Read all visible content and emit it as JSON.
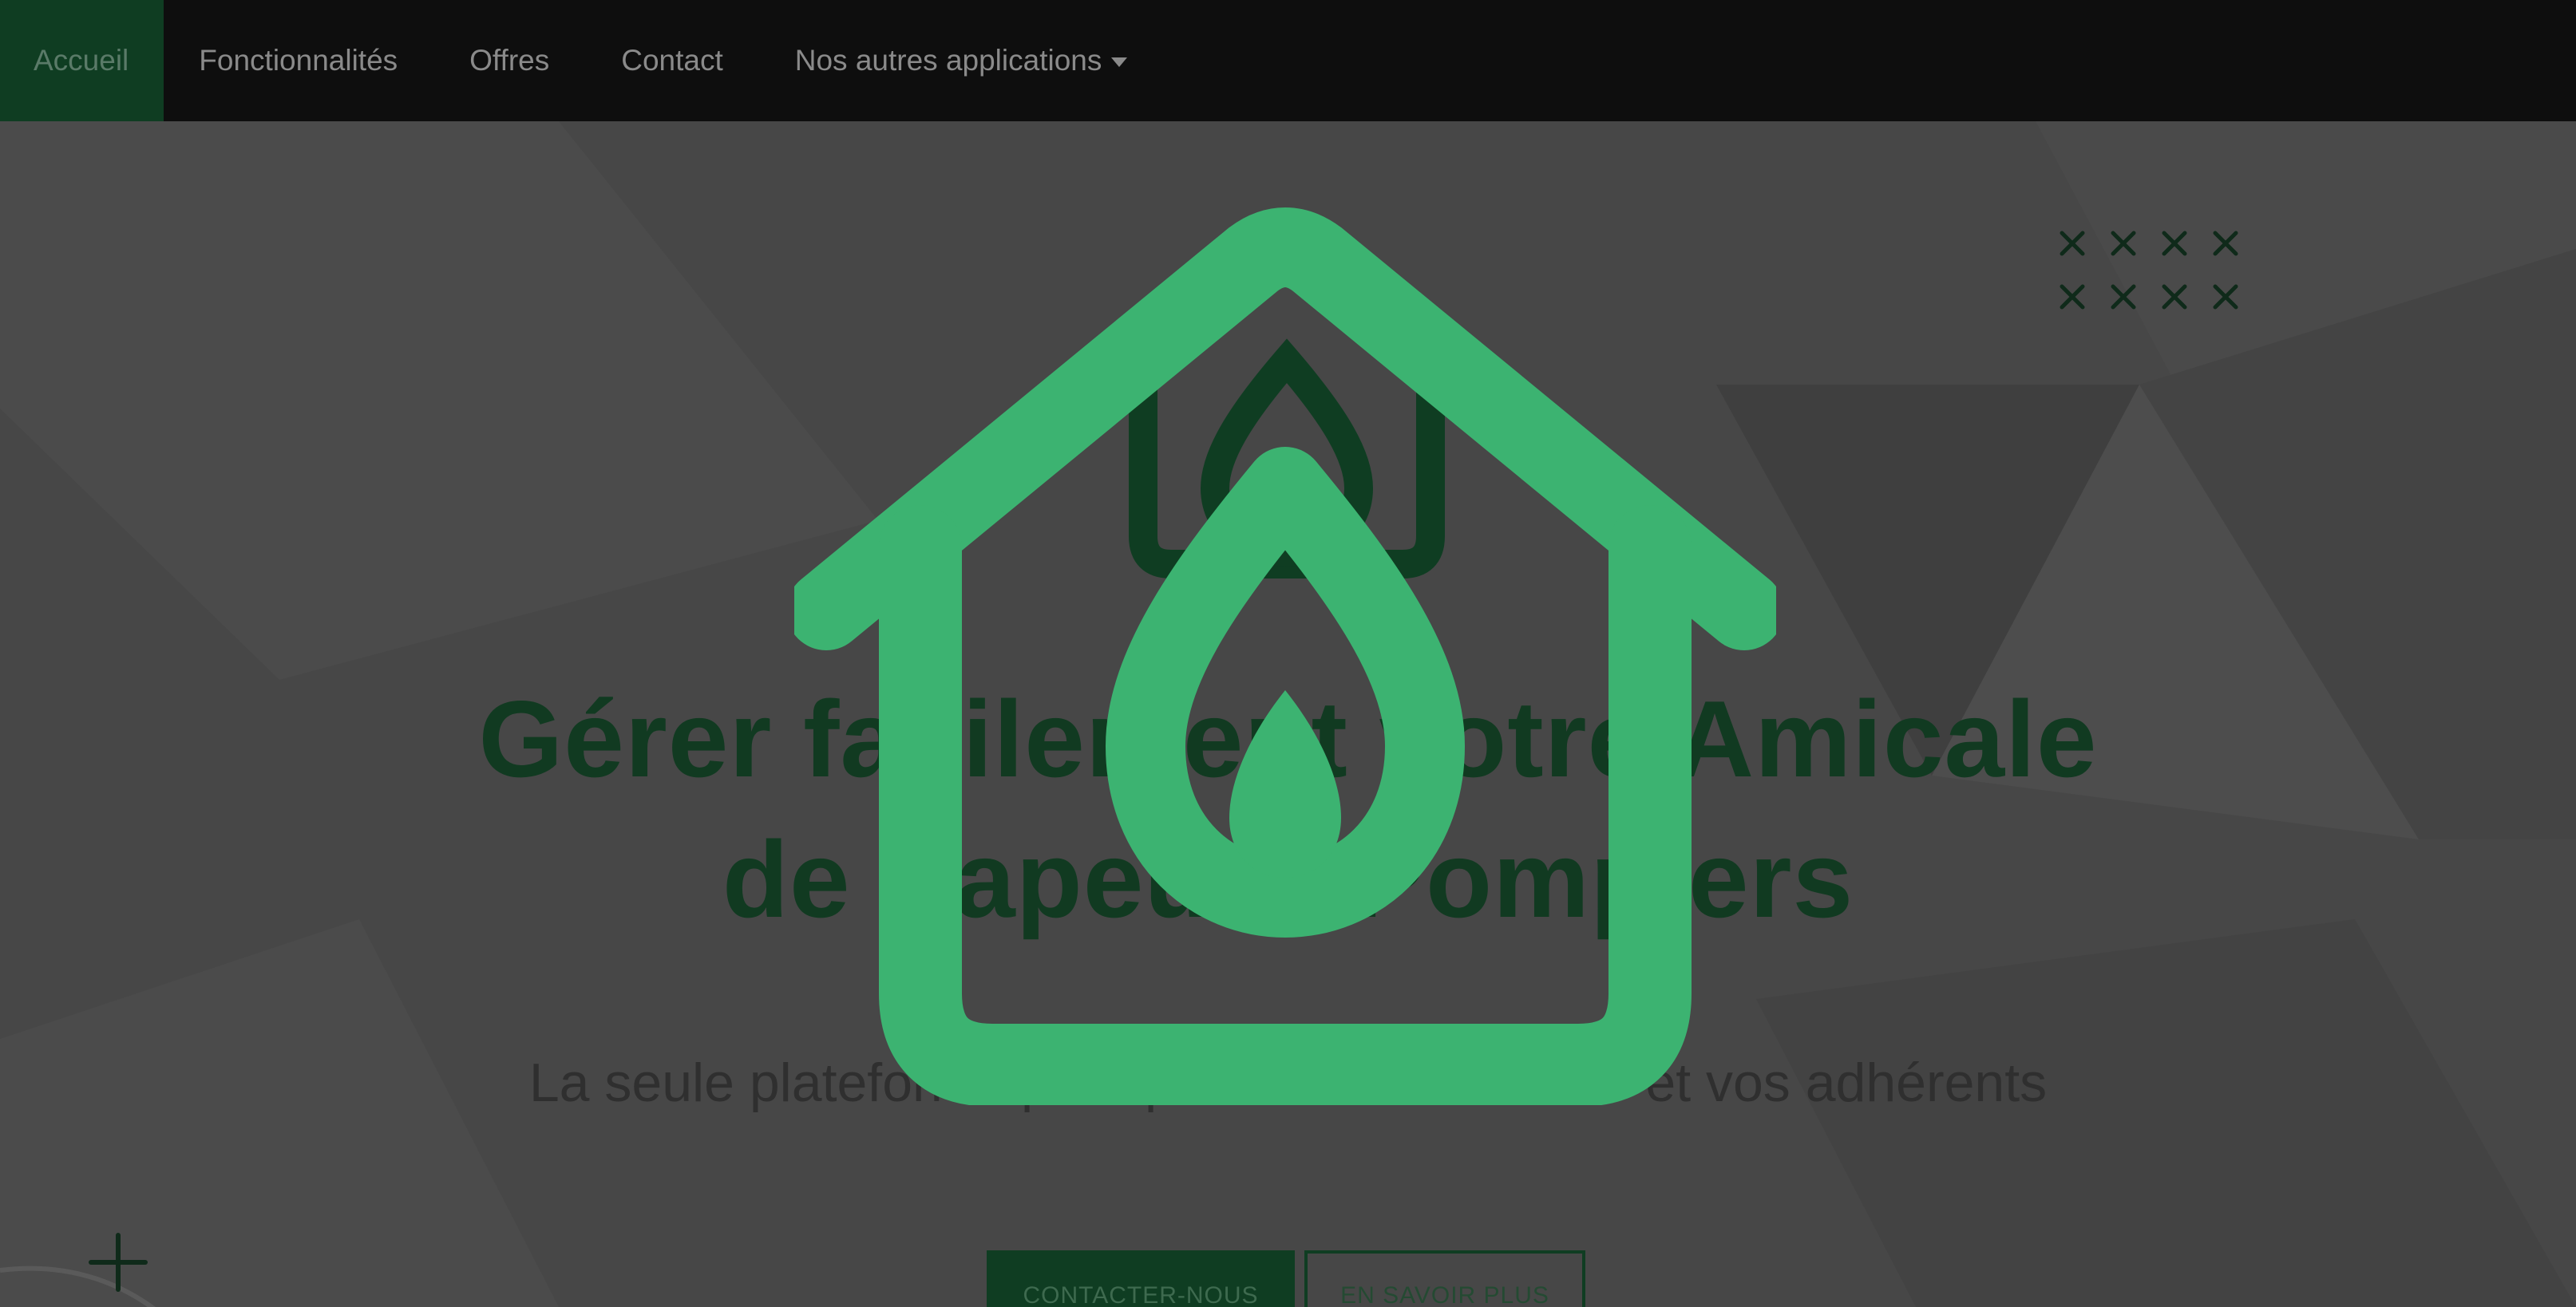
{
  "nav": {
    "items": [
      {
        "label": "Accueil",
        "active": true
      },
      {
        "label": "Fonctionnalités",
        "active": false
      },
      {
        "label": "Offres",
        "active": false
      },
      {
        "label": "Contact",
        "active": false
      },
      {
        "label": "Nos autres applications",
        "active": false,
        "has_dropdown": true
      }
    ]
  },
  "hero": {
    "title_line1": "Gérer facilement votre Amicale",
    "title_line2": "de Sapeurs-Pompiers",
    "subtitle": "La seule plateforme pour piloter votre amicale et vos adhérents"
  },
  "buttons": {
    "primary_label": "CONTACTER-NOUS",
    "secondary_label": "EN SAVOIR PLUS"
  },
  "icons": {
    "logo": "house-flame-logo-icon",
    "caret": "caret-down-icon",
    "decor_x": "x-pattern-icon",
    "decor_plus": "plus-icon"
  },
  "colors": {
    "brand_green": "#3cb371",
    "dark_green": "#0f3d22",
    "navbar": "#0e0e0e",
    "overlay_bg": "#474747"
  }
}
